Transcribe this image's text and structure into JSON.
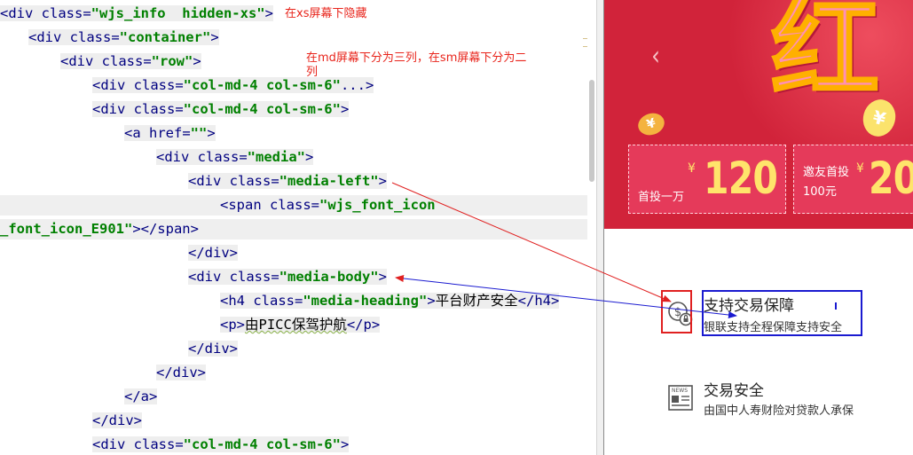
{
  "editor": {
    "lines": [
      {
        "indent": 0,
        "parts": [
          [
            "tag",
            "<div class="
          ],
          [
            "str",
            "\"wjs_info  hidden-xs\""
          ],
          [
            "tag",
            ">"
          ]
        ],
        "note": "在xs屏幕下隐藏"
      },
      {
        "indent": 32,
        "parts": [
          [
            "tag",
            "<div class="
          ],
          [
            "str",
            "\"container\""
          ],
          [
            "tag",
            ">"
          ]
        ]
      },
      {
        "indent": 68,
        "parts": [
          [
            "tag",
            "<div class="
          ],
          [
            "str",
            "\"row\""
          ],
          [
            "tag",
            ">"
          ]
        ]
      },
      {
        "indent": 104,
        "parts": [
          [
            "tag",
            "<div class="
          ],
          [
            "str",
            "\"col-md-4 col-sm-6\""
          ],
          [
            "tag",
            "..."
          ],
          [
            "tag",
            ">"
          ]
        ]
      },
      {
        "indent": 104,
        "parts": [
          [
            "tag",
            "<div class="
          ],
          [
            "str",
            "\"col-md-4 col-sm-6\""
          ],
          [
            "tag",
            ">"
          ]
        ]
      },
      {
        "indent": 140,
        "parts": [
          [
            "tag",
            "<a href="
          ],
          [
            "str",
            "\"\""
          ],
          [
            "tag",
            ">"
          ]
        ]
      },
      {
        "indent": 176,
        "parts": [
          [
            "tag",
            "<div class="
          ],
          [
            "str",
            "\"media\""
          ],
          [
            "tag",
            ">"
          ]
        ]
      },
      {
        "indent": 212,
        "parts": [
          [
            "tag",
            "<div class="
          ],
          [
            "str",
            "\"media-left\""
          ],
          [
            "tag",
            ">"
          ]
        ]
      },
      {
        "indent": 248,
        "parts": [
          [
            "tag",
            "<span class="
          ],
          [
            "str",
            "\"wjs_font_icon"
          ]
        ],
        "highlight": true
      },
      {
        "indent": 0,
        "parts": [
          [
            "str",
            "_font_icon_E901\""
          ],
          [
            "tag",
            "></span>"
          ]
        ],
        "highlight": true
      },
      {
        "indent": 212,
        "parts": [
          [
            "tag",
            "</div>"
          ]
        ]
      },
      {
        "indent": 212,
        "parts": [
          [
            "tag",
            "<div class="
          ],
          [
            "str",
            "\"media-body\""
          ],
          [
            "tag",
            ">"
          ]
        ]
      },
      {
        "indent": 248,
        "parts": [
          [
            "tag",
            "<h4 class="
          ],
          [
            "str",
            "\"media-heading\""
          ],
          [
            "tag",
            ">"
          ],
          [
            "text",
            "平台财产安全"
          ],
          [
            "tag",
            "</h4>"
          ]
        ]
      },
      {
        "indent": 248,
        "parts": [
          [
            "tag",
            "<p>"
          ],
          [
            "squig",
            "由PICC保驾护航"
          ],
          [
            "tag",
            "</p>"
          ]
        ]
      },
      {
        "indent": 212,
        "parts": [
          [
            "tag",
            "</div>"
          ]
        ]
      },
      {
        "indent": 176,
        "parts": [
          [
            "tag",
            "</div>"
          ]
        ]
      },
      {
        "indent": 140,
        "parts": [
          [
            "tag",
            "</a>"
          ]
        ]
      },
      {
        "indent": 104,
        "parts": [
          [
            "tag",
            "</div>"
          ]
        ]
      },
      {
        "indent": 104,
        "parts": [
          [
            "tag",
            "<div class="
          ],
          [
            "str",
            "\"col-md-4 col-sm-6\""
          ],
          [
            "tag",
            ">"
          ]
        ]
      }
    ],
    "annotation": "在md屏幕下分为三列，在sm屏幕下分为二列"
  },
  "preview": {
    "banner": {
      "prev_arrow": "‹",
      "headline_char": "红",
      "coin_left": "¥",
      "coin_right": "¥",
      "coupons": [
        {
          "currency": "¥",
          "amount": "120",
          "label": "首投一万"
        },
        {
          "currency": "¥",
          "amount": "20",
          "label_line1": "邀友首投",
          "label_line2": "100元"
        }
      ]
    },
    "features": [
      {
        "icon": "dollar-lock-icon",
        "title": "支持交易保障",
        "desc": "银联支持全程保障支持安全"
      },
      {
        "icon": "news-icon",
        "title": "交易安全",
        "desc": "由国中人寿财险对贷款人承保"
      }
    ]
  },
  "colors": {
    "note_red": "#e8241b",
    "banner_red": "#d1233a",
    "coupon_red": "#e53a5a",
    "gold": "#ffe46b",
    "annotation_red": "#e02020",
    "annotation_blue": "#1a1ad0"
  }
}
